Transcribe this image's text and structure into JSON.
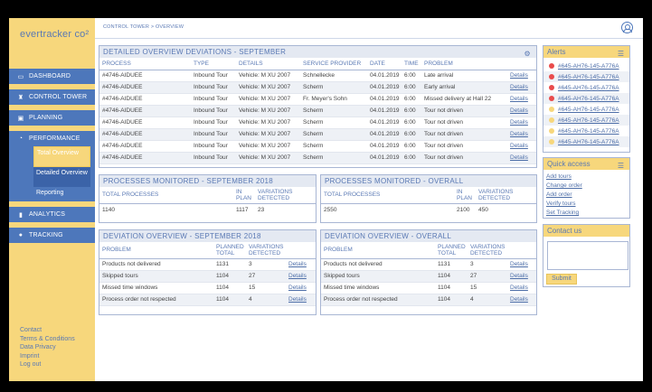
{
  "app": {
    "logo": "evertracker co²",
    "breadcrumb": "CONTROL TOWER > OVERVIEW"
  },
  "sidebar": {
    "items": [
      {
        "label": "DASHBOARD",
        "icon": "monitor-icon"
      },
      {
        "label": "CONTROL TOWER",
        "icon": "tower-icon"
      },
      {
        "label": "PLANNING",
        "icon": "planning-icon"
      },
      {
        "label": "PERFORMANCE",
        "icon": "gauge-icon"
      },
      {
        "label": "ANALYTICS",
        "icon": "bar-chart-icon"
      },
      {
        "label": "TRACKING",
        "icon": "pin-icon"
      }
    ],
    "performance_sub": [
      "Total Overview",
      "Detailed Overview",
      "Reporting"
    ],
    "footer": [
      "Contact",
      "Terms & Conditions",
      "Data Privacy",
      "Imprint",
      "Log out"
    ]
  },
  "deviations": {
    "title": "DETAILED OVERVIEW DEVIATIONS - SEPTEMBER",
    "columns": [
      "PROCESS",
      "TYPE",
      "DETAILS",
      "SERVICE PROVIDER",
      "DATE",
      "TIME",
      "PROBLEM",
      ""
    ],
    "rows": [
      [
        "#4746-AIDUEE",
        "Inbound Tour",
        "Vehicle: M XU 2007",
        "Schnellecke",
        "04.01.2019",
        "6:00",
        "Late arrival",
        "Details"
      ],
      [
        "#4746-AIDUEE",
        "Inbound Tour",
        "Vehicle: M XU 2007",
        "Scherm",
        "04.01.2019",
        "6:00",
        "Early arrival",
        "Details"
      ],
      [
        "#4746-AIDUEE",
        "Inbound Tour",
        "Vehicle: M XU 2007",
        "Fr. Meyer's Sohn",
        "04.01.2019",
        "6:00",
        "Missed delivery at Hall 22",
        "Details"
      ],
      [
        "#4746-AIDUEE",
        "Inbound Tour",
        "Vehicle: M XU 2007",
        "Scherm",
        "04.01.2019",
        "6:00",
        "Tour not driven",
        "Details"
      ],
      [
        "#4746-AIDUEE",
        "Inbound Tour",
        "Vehicle: M XU 2007",
        "Scherm",
        "04.01.2019",
        "6:00",
        "Tour not driven",
        "Details"
      ],
      [
        "#4746-AIDUEE",
        "Inbound Tour",
        "Vehicle: M XU 2007",
        "Scherm",
        "04.01.2019",
        "6:00",
        "Tour not driven",
        "Details"
      ],
      [
        "#4746-AIDUEE",
        "Inbound Tour",
        "Vehicle: M XU 2007",
        "Scherm",
        "04.01.2019",
        "6:00",
        "Tour not driven",
        "Details"
      ],
      [
        "#4746-AIDUEE",
        "Inbound Tour",
        "Vehicle: M XU 2007",
        "Scherm",
        "04.01.2019",
        "6:00",
        "Tour not driven",
        "Details"
      ]
    ]
  },
  "monitored_month": {
    "title": "PROCESSES MONITORED - SEPTEMBER 2018",
    "h_total": "TOTAL PROCESSES",
    "h_plan": "IN PLAN",
    "h_var": "VARIATIONS DETECTED",
    "total": "1140",
    "plan": "1117",
    "var": "23"
  },
  "monitored_overall": {
    "title": "PROCESSES MONITORED - OVERALL",
    "h_total": "TOTAL PROCESSES",
    "h_plan": "IN PLAN",
    "h_var": "VARIATIONS DETECTED",
    "total": "2550",
    "plan": "2100",
    "var": "450"
  },
  "dev_month": {
    "title": "DEVIATION OVERVIEW - SEPTEMBER 2018",
    "h_problem": "PROBLEM",
    "h_planned": "PLANNED TOTAL",
    "h_var": "VARIATIONS DETECTED",
    "rows": [
      [
        "Products not delivered",
        "1131",
        "3",
        "Details"
      ],
      [
        "Skipped tours",
        "1104",
        "27",
        "Details"
      ],
      [
        "Missed time windows",
        "1104",
        "15",
        "Details"
      ],
      [
        "Process order not respected",
        "1104",
        "4",
        "Details"
      ]
    ]
  },
  "dev_overall": {
    "title": "DEVIATION OVERVIEW - OVERALL",
    "h_problem": "PROBLEM",
    "h_planned": "PLANNED TOTAL",
    "h_var": "VARIATIONS DETECTED",
    "rows": [
      [
        "Products not delivered",
        "1131",
        "3",
        "Details"
      ],
      [
        "Skipped tours",
        "1104",
        "27",
        "Details"
      ],
      [
        "Missed time windows",
        "1104",
        "15",
        "Details"
      ],
      [
        "Process order not respected",
        "1104",
        "4",
        "Details"
      ]
    ]
  },
  "alerts": {
    "title": "Alerts",
    "items": [
      {
        "text": "#645-AH76-145-A776A",
        "color": "#e94b4b"
      },
      {
        "text": "#645-AH76-145-A776A",
        "color": "#e94b4b"
      },
      {
        "text": "#645-AH76-145-A776A",
        "color": "#e94b4b"
      },
      {
        "text": "#645-AH76-145-A776A",
        "color": "#e94b4b"
      },
      {
        "text": "#645-AH76-145-A776A",
        "color": "#f7d77c"
      },
      {
        "text": "#645-AH76-145-A776A",
        "color": "#f7d77c"
      },
      {
        "text": "#645-AH76-145-A776A",
        "color": "#f7d77c"
      },
      {
        "text": "#645-AH76-145-A776A",
        "color": "#f7d77c"
      }
    ]
  },
  "quick_access": {
    "title": "Quick access",
    "links": [
      "Add tours",
      "Change order",
      "Add order",
      "Verify tours",
      "Set Tracking"
    ]
  },
  "contact": {
    "title": "Contact us",
    "submit": "Submit"
  }
}
